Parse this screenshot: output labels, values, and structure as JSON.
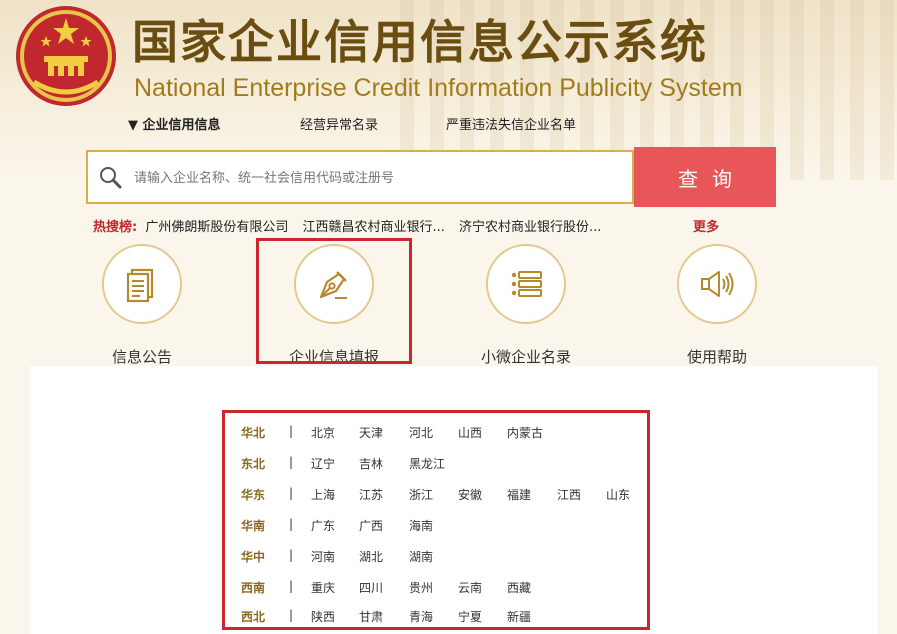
{
  "header": {
    "title_cn": "国家企业信用信息公示系统",
    "title_en": "National Enterprise Credit Information Publicity System"
  },
  "nav": {
    "items": [
      {
        "label": "企业信用信息",
        "active": true
      },
      {
        "label": "经营异常名录",
        "active": false
      },
      {
        "label": "严重违法失信企业名单",
        "active": false
      }
    ]
  },
  "search": {
    "placeholder": "请输入企业名称、统一社会信用代码或注册号",
    "button_label": "查询"
  },
  "hot_search": {
    "label": "热搜榜:",
    "items": [
      "广州佛朗斯股份有限公司",
      "江西赣昌农村商业银行...",
      "济宁农村商业银行股份..."
    ],
    "more_label": "更多"
  },
  "features": [
    {
      "label": "信息公告",
      "icon": "document-icon"
    },
    {
      "label": "企业信息填报",
      "icon": "pen-icon"
    },
    {
      "label": "小微企业名录",
      "icon": "list-icon"
    },
    {
      "label": "使用帮助",
      "icon": "speaker-icon"
    }
  ],
  "regions": [
    {
      "name": "华北",
      "cities": [
        "北京",
        "天津",
        "河北",
        "山西",
        "内蒙古"
      ]
    },
    {
      "name": "东北",
      "cities": [
        "辽宁",
        "吉林",
        "黑龙江"
      ]
    },
    {
      "name": "华东",
      "cities": [
        "上海",
        "江苏",
        "浙江",
        "安徽",
        "福建",
        "江西",
        "山东"
      ]
    },
    {
      "name": "华南",
      "cities": [
        "广东",
        "广西",
        "海南"
      ]
    },
    {
      "name": "华中",
      "cities": [
        "河南",
        "湖北",
        "湖南"
      ]
    },
    {
      "name": "西南",
      "cities": [
        "重庆",
        "四川",
        "贵州",
        "云南",
        "西藏"
      ]
    },
    {
      "name": "西北",
      "cities": [
        "陕西",
        "甘肃",
        "青海",
        "宁夏",
        "新疆"
      ]
    }
  ],
  "colors": {
    "accent_red": "#e85659",
    "highlight_red": "#c9262d",
    "gold": "#d7b04a",
    "title_brown": "#6a4d10"
  }
}
